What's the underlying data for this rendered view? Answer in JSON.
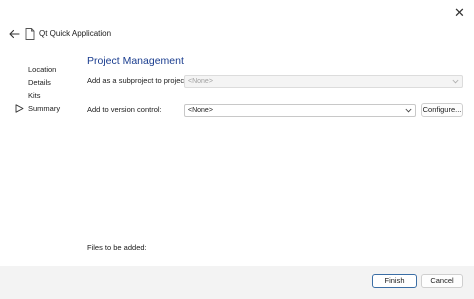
{
  "window": {
    "close_glyph": "✕"
  },
  "header": {
    "title": "Qt Quick Application",
    "back_icon": "arrow-left-icon",
    "app_icon": "document-icon"
  },
  "sidebar": {
    "steps": [
      {
        "label": "Location",
        "current": false
      },
      {
        "label": "Details",
        "current": false
      },
      {
        "label": "Kits",
        "current": false
      },
      {
        "label": "Summary",
        "current": true
      }
    ]
  },
  "main": {
    "title": "Project Management",
    "subproject": {
      "label": "Add as a subproject to project:",
      "value": "<None>",
      "enabled": false
    },
    "version_control": {
      "label": "Add to version control:",
      "value": "<None>",
      "enabled": true
    },
    "configure_label": "Configure...",
    "files_label": "Files to be added:"
  },
  "footer": {
    "finish_label": "Finish",
    "cancel_label": "Cancel"
  },
  "colors": {
    "title_blue": "#1a3d8f",
    "footer_bg": "#f3f3f3",
    "primary_border": "#3b6ea5"
  }
}
